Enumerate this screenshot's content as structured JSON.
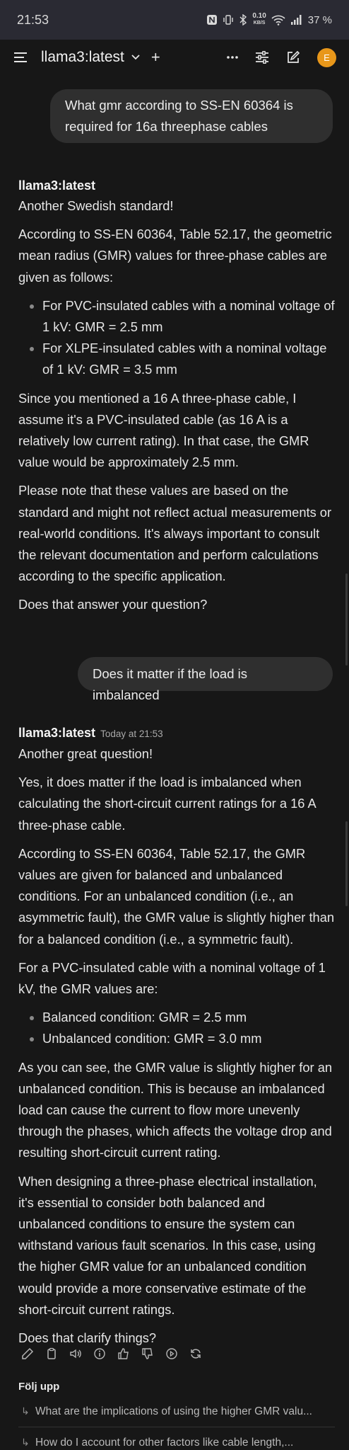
{
  "status": {
    "time": "21:53",
    "net_speed": "0.10",
    "net_unit": "KB/S",
    "battery": "37 %"
  },
  "topbar": {
    "model": "llama3:latest",
    "plus": "+",
    "avatar_letter": "E",
    "avatar_color": "#e8971a"
  },
  "messages": {
    "user1": "What gmr according to SS-EN 60364 is required for 16a threephase cables",
    "assistant1": {
      "name": "llama3:latest",
      "p1": "Another Swedish standard!",
      "p2": "According to SS-EN 60364, Table 52.17, the geometric mean radius (GMR) values for three-phase cables are given as follows:",
      "li1": "For PVC-insulated cables with a nominal voltage of 1 kV: GMR = 2.5 mm",
      "li2": "For XLPE-insulated cables with a nominal voltage of 1 kV: GMR = 3.5 mm",
      "p3": "Since you mentioned a 16 A three-phase cable, I assume it's a PVC-insulated cable (as 16 A is a relatively low current rating). In that case, the GMR value would be approximately 2.5 mm.",
      "p4": "Please note that these values are based on the standard and might not reflect actual measurements or real-world conditions. It's always important to consult the relevant documentation and perform calculations according to the specific application.",
      "p5": "Does that answer your question?"
    },
    "user2": "Does it matter if the load is imbalanced",
    "assistant2": {
      "name": "llama3:latest",
      "time": "Today at 21:53",
      "p1": "Another great question!",
      "p2": "Yes, it does matter if the load is imbalanced when calculating the short-circuit current ratings for a 16 A three-phase cable.",
      "p3": "According to SS-EN 60364, Table 52.17, the GMR values are given for balanced and unbalanced conditions. For an unbalanced condition (i.e., an asymmetric fault), the GMR value is slightly higher than for a balanced condition (i.e., a symmetric fault).",
      "p4": "For a PVC-insulated cable with a nominal voltage of 1 kV, the GMR values are:",
      "li1": "Balanced condition: GMR = 2.5 mm",
      "li2": "Unbalanced condition: GMR = 3.0 mm",
      "p5": "As you can see, the GMR value is slightly higher for an unbalanced condition. This is because an imbalanced load can cause the current to flow more unevenly through the phases, which affects the voltage drop and resulting short-circuit current rating.",
      "p6": "When designing a three-phase electrical installation, it's essential to consider both balanced and unbalanced conditions to ensure the system can withstand various fault scenarios. In this case, using the higher GMR value for an unbalanced condition would provide a more conservative estimate of the short-circuit current ratings.",
      "p7": "Does that clarify things?"
    }
  },
  "action_icons": [
    "edit-icon",
    "copy-icon",
    "speaker-icon",
    "info-icon",
    "thumbs-up-icon",
    "thumbs-down-icon",
    "play-icon",
    "regenerate-icon"
  ],
  "followups": {
    "title": "Följ upp",
    "items": [
      "What are the implications of using the higher GMR valu...",
      "How do I account for other factors like cable length,..."
    ]
  }
}
